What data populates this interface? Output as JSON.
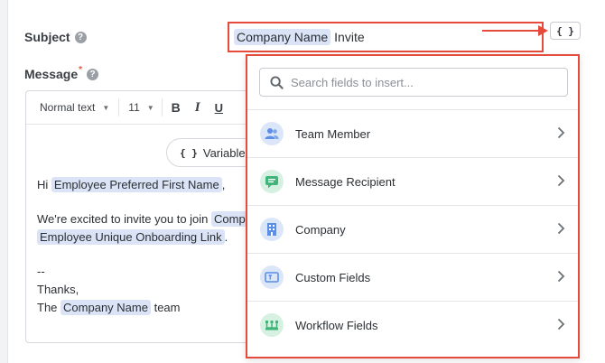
{
  "subject": {
    "label": "Subject",
    "help_glyph": "?",
    "token": "Company Name",
    "text": "Invite"
  },
  "variable_button": {
    "label": "{ }"
  },
  "message": {
    "label": "Message",
    "required_mark": "*",
    "help_glyph": "?"
  },
  "toolbar": {
    "text_style": "Normal text",
    "font_size": "11",
    "bold": "B",
    "italic": "I",
    "underline": "U"
  },
  "variable_chip": {
    "brace": "{ }",
    "label": "Variable"
  },
  "body": {
    "line1_prefix": "Hi",
    "line1_token": "Employee Preferred First Name",
    "line1_suffix": ",",
    "line2_text": "We're excited to invite you to join",
    "line2_token": "Compa",
    "line3_token": "Employee Unique Onboarding Link",
    "line3_suffix": ".",
    "line4": "--",
    "line5": "Thanks,",
    "line6_prefix": "The",
    "line6_token": "Company Name",
    "line6_suffix": "team"
  },
  "dropdown": {
    "search_placeholder": "Search fields to insert...",
    "items": [
      {
        "label": "Team Member",
        "icon": "team-member-icon",
        "color": "#dbe6f8"
      },
      {
        "label": "Message Recipient",
        "icon": "message-icon",
        "color": "#d6f0e2"
      },
      {
        "label": "Company",
        "icon": "building-icon",
        "color": "#dbe6f8"
      },
      {
        "label": "Custom Fields",
        "icon": "custom-field-icon",
        "color": "#dbe6f8"
      },
      {
        "label": "Workflow Fields",
        "icon": "workflow-icon",
        "color": "#d6f0e2"
      }
    ]
  },
  "colors": {
    "highlight": "#e54b3a",
    "token_bg": "#dbe4f7",
    "blue_icon": "#5b8ee6",
    "green_icon": "#3fb57a"
  }
}
